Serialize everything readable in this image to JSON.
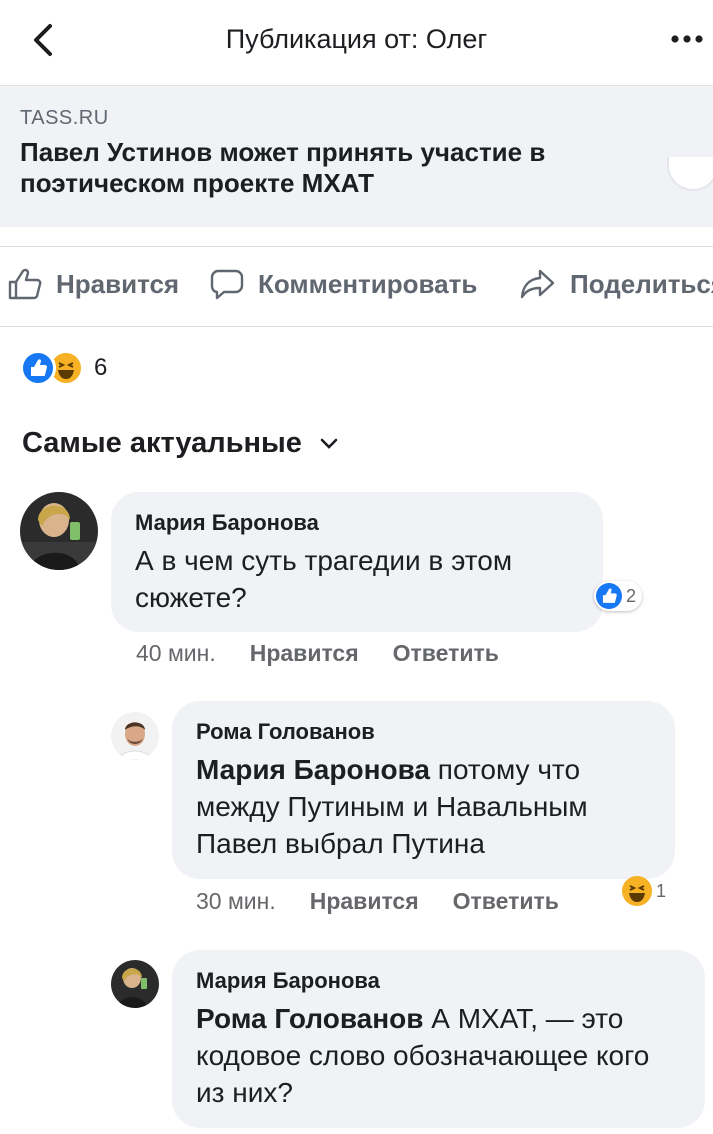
{
  "header": {
    "title": "Публикация от: Олег",
    "back_icon": "chevron-left-icon",
    "more_icon": "ellipsis-icon"
  },
  "link_preview": {
    "domain": "TASS.RU",
    "title": "Павел Устинов может принять участие в поэтическом проекте МХАТ"
  },
  "actions": {
    "like": "Нравится",
    "comment": "Комментировать",
    "share": "Поделиться"
  },
  "reactions": {
    "count": "6",
    "types": [
      "like",
      "haha"
    ]
  },
  "sort": {
    "label": "Самые актуальные"
  },
  "comments": [
    {
      "author": "Мария Баронова",
      "mention": "",
      "text": "А в чем суть трагедии в этом сюжете?",
      "time": "40 мин.",
      "like_label": "Нравится",
      "reply_label": "Ответить",
      "reaction": "like",
      "reaction_count": "2"
    },
    {
      "author": "Рома Голованов",
      "mention": "Мария Баронова",
      "text": " потому что между Путиным и Навальным Павел выбрал Путина",
      "time": "30 мин.",
      "like_label": "Нравится",
      "reply_label": "Ответить",
      "reaction": "haha",
      "reaction_count": "1"
    },
    {
      "author": "Мария Баронова",
      "mention": "Рома Голованов",
      "text": " А МХАТ, — это кодовое слово обозначающее кого из них?"
    }
  ],
  "colors": {
    "accent": "#1877f2",
    "haha": "#f7b125",
    "bubble": "#f0f2f5",
    "muted": "#65676b"
  }
}
